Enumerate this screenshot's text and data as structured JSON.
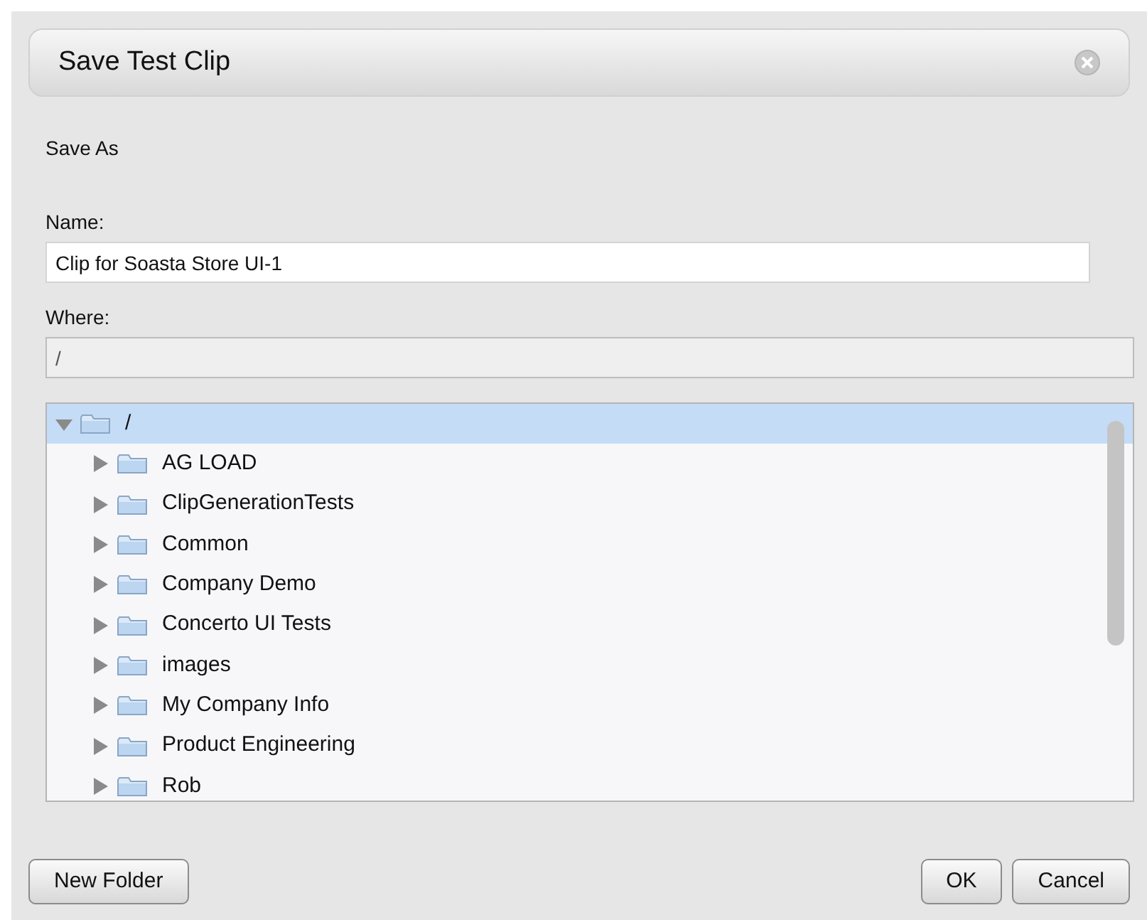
{
  "dialog": {
    "title": "Save Test Clip"
  },
  "section_label": "Save As",
  "name_field": {
    "label": "Name:",
    "value": "Clip for Soasta Store UI-1"
  },
  "where_field": {
    "label": "Where:",
    "value": "/",
    "disabled": true
  },
  "folder_tree": [
    {
      "label": "/",
      "expanded": true,
      "selected": true,
      "children": [
        {
          "label": "AG LOAD",
          "expanded": false,
          "selected": false
        },
        {
          "label": "ClipGenerationTests",
          "expanded": false,
          "selected": false
        },
        {
          "label": "Common",
          "expanded": false,
          "selected": false
        },
        {
          "label": "Company Demo",
          "expanded": false,
          "selected": false
        },
        {
          "label": "Concerto UI Tests",
          "expanded": false,
          "selected": false
        },
        {
          "label": "images",
          "expanded": false,
          "selected": false
        },
        {
          "label": "My Company Info",
          "expanded": false,
          "selected": false
        },
        {
          "label": "Product Engineering",
          "expanded": false,
          "selected": false
        },
        {
          "label": "Rob",
          "expanded": false,
          "selected": false
        }
      ]
    }
  ],
  "buttons": [
    {
      "label": "New Folder",
      "kind": "left"
    },
    {
      "label": "OK",
      "kind": "right"
    },
    {
      "label": "Cancel",
      "kind": "right"
    }
  ]
}
